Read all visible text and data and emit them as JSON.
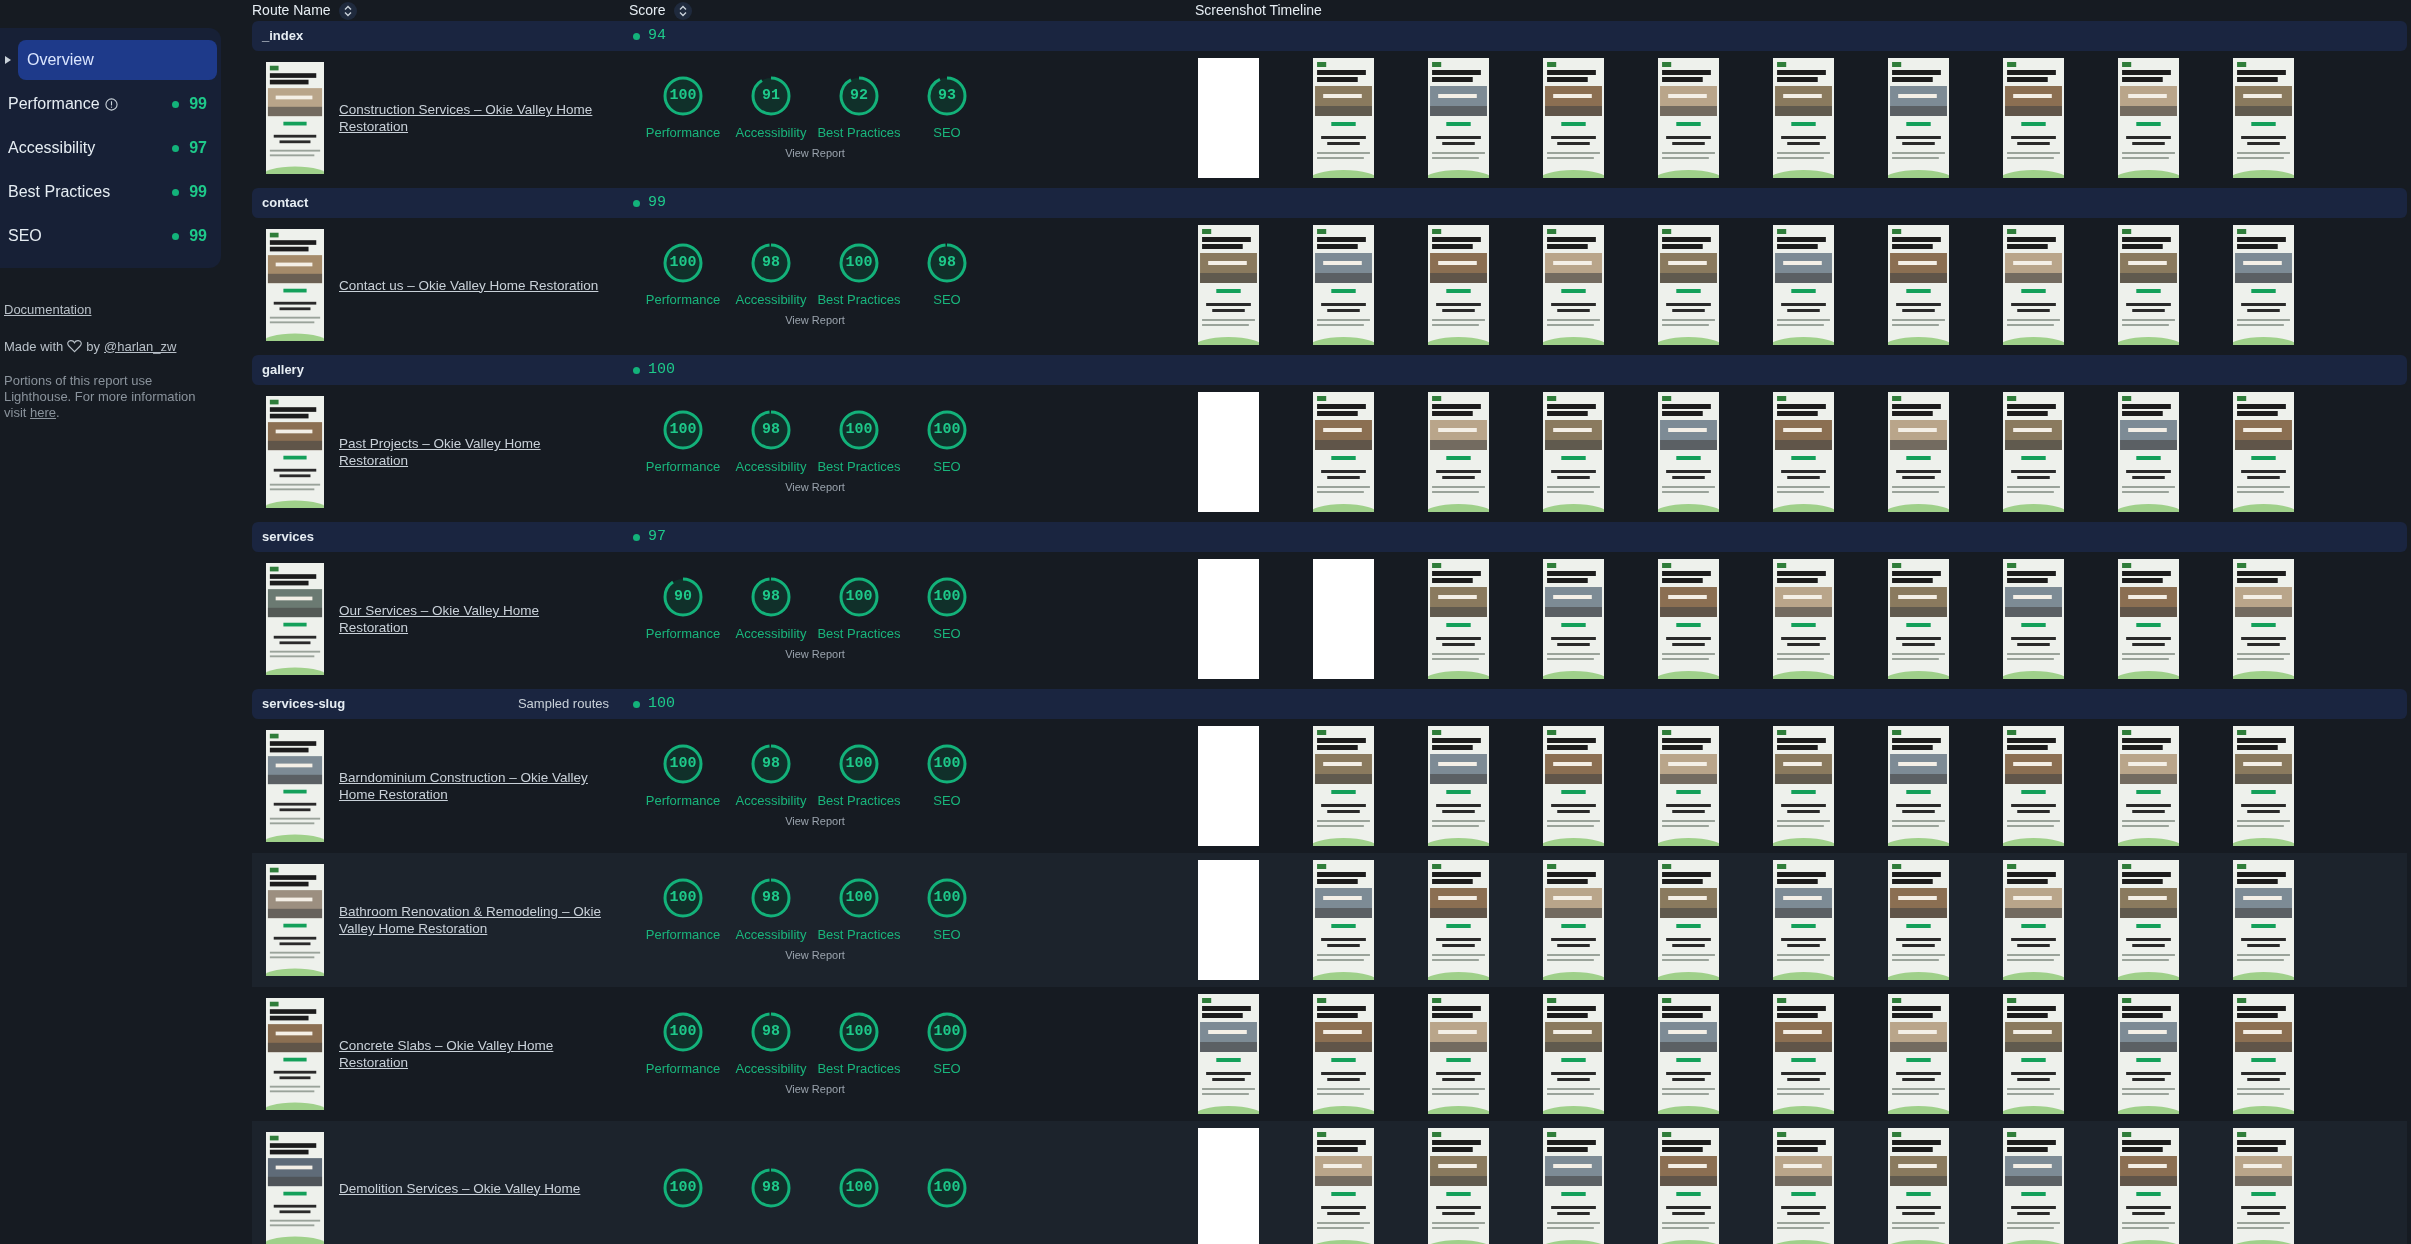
{
  "sidebar": {
    "items": [
      {
        "label": "Overview",
        "selected": true
      },
      {
        "label": "Performance",
        "info": true,
        "score": "99",
        "selected": false
      },
      {
        "label": "Accessibility",
        "score": "97",
        "selected": false
      },
      {
        "label": "Best Practices",
        "score": "99",
        "selected": false
      },
      {
        "label": "SEO",
        "score": "99",
        "selected": false
      }
    ],
    "documentation": "Documentation",
    "made_with": {
      "prefix": "Made with",
      "middle": "by",
      "link": "@harlan_zw"
    },
    "notice": {
      "text": "Portions of this report use Lighthouse. For more information visit",
      "link": "here",
      "end": "."
    }
  },
  "table": {
    "columns": [
      {
        "label": "Route Name",
        "sortable": true
      },
      {
        "label": "Score",
        "sortable": true
      },
      {
        "label": "Screenshot Timeline",
        "sortable": false
      }
    ],
    "groups": [
      {
        "name": "_index",
        "score": "94",
        "routes": [
          {
            "title": "Construction Services – Okie Valley Home Restoration",
            "gauges": [
              {
                "label": "Performance",
                "score": "100"
              },
              {
                "label": "Accessibility",
                "score": "91"
              },
              {
                "label": "Best Practices",
                "score": "92"
              },
              {
                "label": "SEO",
                "score": "93"
              }
            ],
            "report": "View Report",
            "frames": [
              {
                "kind": "blank"
              },
              {
                "kind": "picture"
              },
              {
                "kind": "picture"
              },
              {
                "kind": "picture"
              },
              {
                "kind": "picture"
              },
              {
                "kind": "picture"
              },
              {
                "kind": "picture"
              },
              {
                "kind": "picture"
              },
              {
                "kind": "picture"
              },
              {
                "kind": "picture"
              }
            ]
          }
        ]
      },
      {
        "name": "contact",
        "score": "99",
        "routes": [
          {
            "title": "Contact us – Okie Valley Home Restoration",
            "gauges": [
              {
                "label": "Performance",
                "score": "100"
              },
              {
                "label": "Accessibility",
                "score": "98"
              },
              {
                "label": "Best Practices",
                "score": "100"
              },
              {
                "label": "SEO",
                "score": "98"
              }
            ],
            "report": "View Report",
            "frames": [
              {
                "kind": "picture"
              },
              {
                "kind": "picture"
              },
              {
                "kind": "picture"
              },
              {
                "kind": "picture"
              },
              {
                "kind": "picture"
              },
              {
                "kind": "picture"
              },
              {
                "kind": "picture"
              },
              {
                "kind": "picture"
              },
              {
                "kind": "picture"
              },
              {
                "kind": "picture"
              }
            ]
          }
        ]
      },
      {
        "name": "gallery",
        "score": "100",
        "routes": [
          {
            "title": "Past Projects – Okie Valley Home Restoration",
            "gauges": [
              {
                "label": "Performance",
                "score": "100"
              },
              {
                "label": "Accessibility",
                "score": "98"
              },
              {
                "label": "Best Practices",
                "score": "100"
              },
              {
                "label": "SEO",
                "score": "100"
              }
            ],
            "report": "View Report",
            "frames": [
              {
                "kind": "blank"
              },
              {
                "kind": "picture"
              },
              {
                "kind": "picture"
              },
              {
                "kind": "picture"
              },
              {
                "kind": "picture"
              },
              {
                "kind": "picture"
              },
              {
                "kind": "picture"
              },
              {
                "kind": "picture"
              },
              {
                "kind": "picture"
              },
              {
                "kind": "picture"
              }
            ]
          }
        ]
      },
      {
        "name": "services",
        "score": "97",
        "routes": [
          {
            "title": "Our Services – Okie Valley Home Restoration",
            "gauges": [
              {
                "label": "Performance",
                "score": "90"
              },
              {
                "label": "Accessibility",
                "score": "98"
              },
              {
                "label": "Best Practices",
                "score": "100"
              },
              {
                "label": "SEO",
                "score": "100"
              }
            ],
            "report": "View Report",
            "frames": [
              {
                "kind": "blank"
              },
              {
                "kind": "blank"
              },
              {
                "kind": "picture"
              },
              {
                "kind": "picture"
              },
              {
                "kind": "picture"
              },
              {
                "kind": "picture"
              },
              {
                "kind": "picture"
              },
              {
                "kind": "picture"
              },
              {
                "kind": "picture"
              },
              {
                "kind": "picture"
              }
            ]
          }
        ]
      },
      {
        "name": "services-slug",
        "note": "Sampled routes",
        "score": "100",
        "routes": [
          {
            "title": "Barndominium Construction – Okie Valley Home Restoration",
            "gauges": [
              {
                "label": "Performance",
                "score": "100"
              },
              {
                "label": "Accessibility",
                "score": "98"
              },
              {
                "label": "Best Practices",
                "score": "100"
              },
              {
                "label": "SEO",
                "score": "100"
              }
            ],
            "report": "View Report",
            "frames": [
              {
                "kind": "blank"
              },
              {
                "kind": "picture"
              },
              {
                "kind": "picture"
              },
              {
                "kind": "picture"
              },
              {
                "kind": "picture"
              },
              {
                "kind": "picture"
              },
              {
                "kind": "picture"
              },
              {
                "kind": "picture"
              },
              {
                "kind": "picture"
              },
              {
                "kind": "picture"
              }
            ]
          },
          {
            "title": "Bathroom Renovation & Remodeling – Okie Valley Home Restoration",
            "gauges": [
              {
                "label": "Performance",
                "score": "100"
              },
              {
                "label": "Accessibility",
                "score": "98"
              },
              {
                "label": "Best Practices",
                "score": "100"
              },
              {
                "label": "SEO",
                "score": "100"
              }
            ],
            "report": "View Report",
            "frames": [
              {
                "kind": "blank"
              },
              {
                "kind": "picture"
              },
              {
                "kind": "picture"
              },
              {
                "kind": "picture"
              },
              {
                "kind": "picture"
              },
              {
                "kind": "picture"
              },
              {
                "kind": "picture"
              },
              {
                "kind": "picture"
              },
              {
                "kind": "picture"
              },
              {
                "kind": "picture"
              }
            ]
          },
          {
            "title": "Concrete Slabs – Okie Valley Home Restoration",
            "gauges": [
              {
                "label": "Performance",
                "score": "100"
              },
              {
                "label": "Accessibility",
                "score": "98"
              },
              {
                "label": "Best Practices",
                "score": "100"
              },
              {
                "label": "SEO",
                "score": "100"
              }
            ],
            "report": "View Report",
            "frames": [
              {
                "kind": "picture"
              },
              {
                "kind": "picture"
              },
              {
                "kind": "picture"
              },
              {
                "kind": "picture"
              },
              {
                "kind": "picture"
              },
              {
                "kind": "picture"
              },
              {
                "kind": "picture"
              },
              {
                "kind": "picture"
              },
              {
                "kind": "picture"
              },
              {
                "kind": "picture"
              }
            ]
          },
          {
            "title": "Demolition Services – Okie Valley Home",
            "gauges": [
              {
                "score": "100"
              },
              {
                "score": "98"
              },
              {
                "score": "100"
              },
              {
                "score": "100"
              }
            ],
            "frames": [
              {
                "kind": "blank"
              },
              {
                "kind": "picture"
              },
              {
                "kind": "picture"
              },
              {
                "kind": "picture"
              },
              {
                "kind": "picture"
              },
              {
                "kind": "picture"
              },
              {
                "kind": "picture"
              },
              {
                "kind": "picture"
              },
              {
                "kind": "picture"
              },
              {
                "kind": "picture"
              }
            ]
          }
        ]
      }
    ]
  }
}
